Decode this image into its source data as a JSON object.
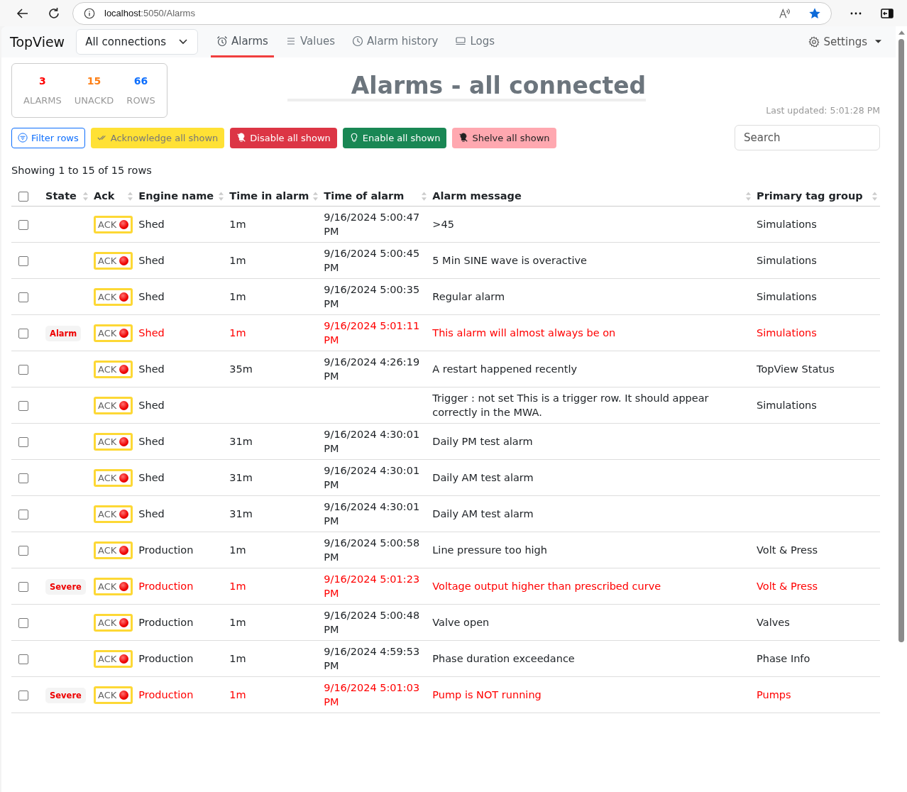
{
  "browser": {
    "url_host": "localhost",
    "url_path": ":5050/Alarms"
  },
  "navbar": {
    "brand": "TopView",
    "connection_select": "All connections",
    "tabs": [
      {
        "label": "Alarms",
        "selected": true
      },
      {
        "label": "Values",
        "selected": false
      },
      {
        "label": "Alarm history",
        "selected": false
      },
      {
        "label": "Logs",
        "selected": false
      }
    ],
    "settings": "Settings"
  },
  "summary": [
    {
      "value": "3",
      "label": "ALARMS",
      "color": "#ff0000"
    },
    {
      "value": "15",
      "label": "UNACKD",
      "color": "#fd7e14"
    },
    {
      "value": "66",
      "label": "ROWS",
      "color": "#0d6efd"
    }
  ],
  "title": "Alarms - all connected",
  "last_updated": "Last updated: 5:01:28 PM",
  "actions": [
    {
      "label": "Filter rows",
      "kind": "filter"
    },
    {
      "label": "Acknowledge all shown",
      "kind": "acknowledge"
    },
    {
      "label": "Disable all shown",
      "kind": "disable"
    },
    {
      "label": "Enable all shown",
      "kind": "enable"
    },
    {
      "label": "Shelve all shown",
      "kind": "shelve"
    }
  ],
  "search": {
    "placeholder": "Search"
  },
  "showing": "Showing 1 to 15 of 15 rows",
  "table": {
    "select_all_checked": false,
    "columns": [
      "State",
      "Ack",
      "Engine name",
      "Time in alarm",
      "Time of alarm",
      "Alarm message",
      "Primary tag group"
    ],
    "rows": [
      {
        "checked": false,
        "state": null,
        "active": false,
        "ack": "ACK",
        "engine": "Shed",
        "time_in": "1m",
        "time_of": "9/16/2024 5:00:47 PM",
        "message": ">45",
        "group": "Simulations"
      },
      {
        "checked": false,
        "state": null,
        "active": false,
        "ack": "ACK",
        "engine": "Shed",
        "time_in": "1m",
        "time_of": "9/16/2024 5:00:45 PM",
        "message": "5 Min SINE wave is overactive",
        "group": "Simulations"
      },
      {
        "checked": false,
        "state": null,
        "active": false,
        "ack": "ACK",
        "engine": "Shed",
        "time_in": "1m",
        "time_of": "9/16/2024 5:00:35 PM",
        "message": "Regular alarm",
        "group": "Simulations"
      },
      {
        "checked": false,
        "state": "Alarm",
        "active": true,
        "ack": "ACK",
        "engine": "Shed",
        "time_in": "1m",
        "time_of": "9/16/2024 5:01:11 PM",
        "message": "This alarm will almost always be on",
        "group": "Simulations"
      },
      {
        "checked": false,
        "state": null,
        "active": false,
        "ack": "ACK",
        "engine": "Shed",
        "time_in": "35m",
        "time_of": "9/16/2024 4:26:19 PM",
        "message": "A restart happened recently",
        "group": "TopView Status"
      },
      {
        "checked": false,
        "state": null,
        "active": false,
        "ack": "ACK",
        "engine": "Shed",
        "time_in": null,
        "time_of": null,
        "message": "Trigger : not set This is a trigger row. It should appear correctly in the MWA.",
        "group": "Simulations"
      },
      {
        "checked": false,
        "state": null,
        "active": false,
        "ack": "ACK",
        "engine": "Shed",
        "time_in": "31m",
        "time_of": "9/16/2024 4:30:01 PM",
        "message": "Daily PM test alarm",
        "group": null
      },
      {
        "checked": false,
        "state": null,
        "active": false,
        "ack": "ACK",
        "engine": "Shed",
        "time_in": "31m",
        "time_of": "9/16/2024 4:30:01 PM",
        "message": "Daily AM test alarm",
        "group": null
      },
      {
        "checked": false,
        "state": null,
        "active": false,
        "ack": "ACK",
        "engine": "Shed",
        "time_in": "31m",
        "time_of": "9/16/2024 4:30:01 PM",
        "message": "Daily AM test alarm",
        "group": null
      },
      {
        "checked": false,
        "state": null,
        "active": false,
        "ack": "ACK",
        "engine": "Production",
        "time_in": "1m",
        "time_of": "9/16/2024 5:00:58 PM",
        "message": "Line pressure too high",
        "group": "Volt & Press"
      },
      {
        "checked": false,
        "state": "Severe",
        "active": true,
        "ack": "ACK",
        "engine": "Production",
        "time_in": "1m",
        "time_of": "9/16/2024 5:01:23 PM",
        "message": "Voltage output higher than prescribed curve",
        "group": "Volt & Press"
      },
      {
        "checked": false,
        "state": null,
        "active": false,
        "ack": "ACK",
        "engine": "Production",
        "time_in": "1m",
        "time_of": "9/16/2024 5:00:48 PM",
        "message": "Valve open",
        "group": "Valves"
      },
      {
        "checked": false,
        "state": null,
        "active": false,
        "ack": "ACK",
        "engine": "Production",
        "time_in": "1m",
        "time_of": "9/16/2024 4:59:53 PM",
        "message": "Phase duration exceedance",
        "group": "Phase Info"
      },
      {
        "checked": false,
        "state": "Severe",
        "active": true,
        "ack": "ACK",
        "engine": "Production",
        "time_in": "1m",
        "time_of": "9/16/2024 5:01:03 PM",
        "message": "Pump is NOT running",
        "group": "Pumps"
      }
    ]
  }
}
